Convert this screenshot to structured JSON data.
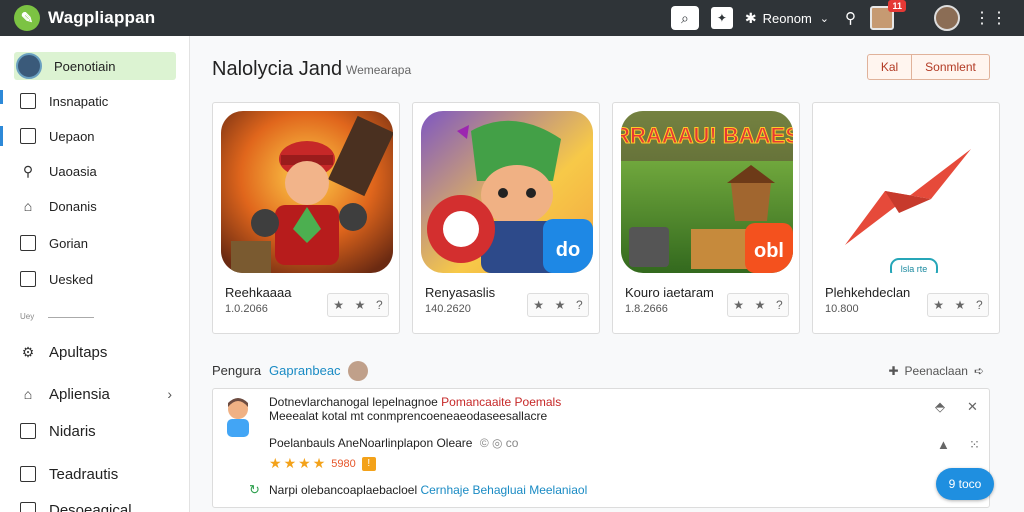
{
  "app": {
    "name": "Wagpliappan"
  },
  "topbar": {
    "search_icon": "search-icon",
    "label": "Reonom"
  },
  "sidebar": {
    "items": [
      {
        "label": "Poenotiain"
      },
      {
        "label": "Insnapatic"
      },
      {
        "label": "Uepaon"
      },
      {
        "label": "Uaoasia"
      },
      {
        "label": "Donanis"
      },
      {
        "label": "Gorian"
      },
      {
        "label": "Uesked"
      },
      {
        "label": "Apultaps"
      },
      {
        "label": "Apliensia"
      },
      {
        "label": "Nidaris"
      },
      {
        "label": "Teadrautis"
      },
      {
        "label": "Desoeagical"
      }
    ],
    "section_label": "Uey"
  },
  "main": {
    "title": "Nalolycia Jand",
    "subtitle": "Wemearapa",
    "btn_1": "Kal",
    "btn_2": "Sonmlent",
    "cards": [
      {
        "name": "Reehkaaaa",
        "meta": "1.0.2066"
      },
      {
        "name": "Renyasaslis",
        "meta": "140.2620"
      },
      {
        "name": "Kouro iaetaram",
        "meta": "1.8.2666"
      },
      {
        "name": "Plehkehdeclan",
        "meta": "10.800"
      }
    ],
    "card_overlays": {
      "art3": "RRAAAU! BAAES",
      "badge2": "do",
      "badge3": "obl",
      "chip4": "lsla rte"
    },
    "section_label": "Pengura",
    "section_link": "Gapranbeac",
    "section_right": "Peenaclaan",
    "review": {
      "title_a": "Dotnevlarchanogal lepelnagnoe ",
      "title_b": "Pomancaaite Poemals",
      "title_c": "Meeealat kotal mt conmprencoeneaeodaseesallacre",
      "line2": "Poelanbauls AneNoarlinplapon Oleare",
      "line2_icons": "© ◎ co",
      "score": "5980",
      "flag": "!",
      "foot_a": "Narpi olebancoaplaebacloel ",
      "foot_b": "Cernhaje Behagluai Meelaniaol"
    },
    "fab_label": "9 toco"
  }
}
